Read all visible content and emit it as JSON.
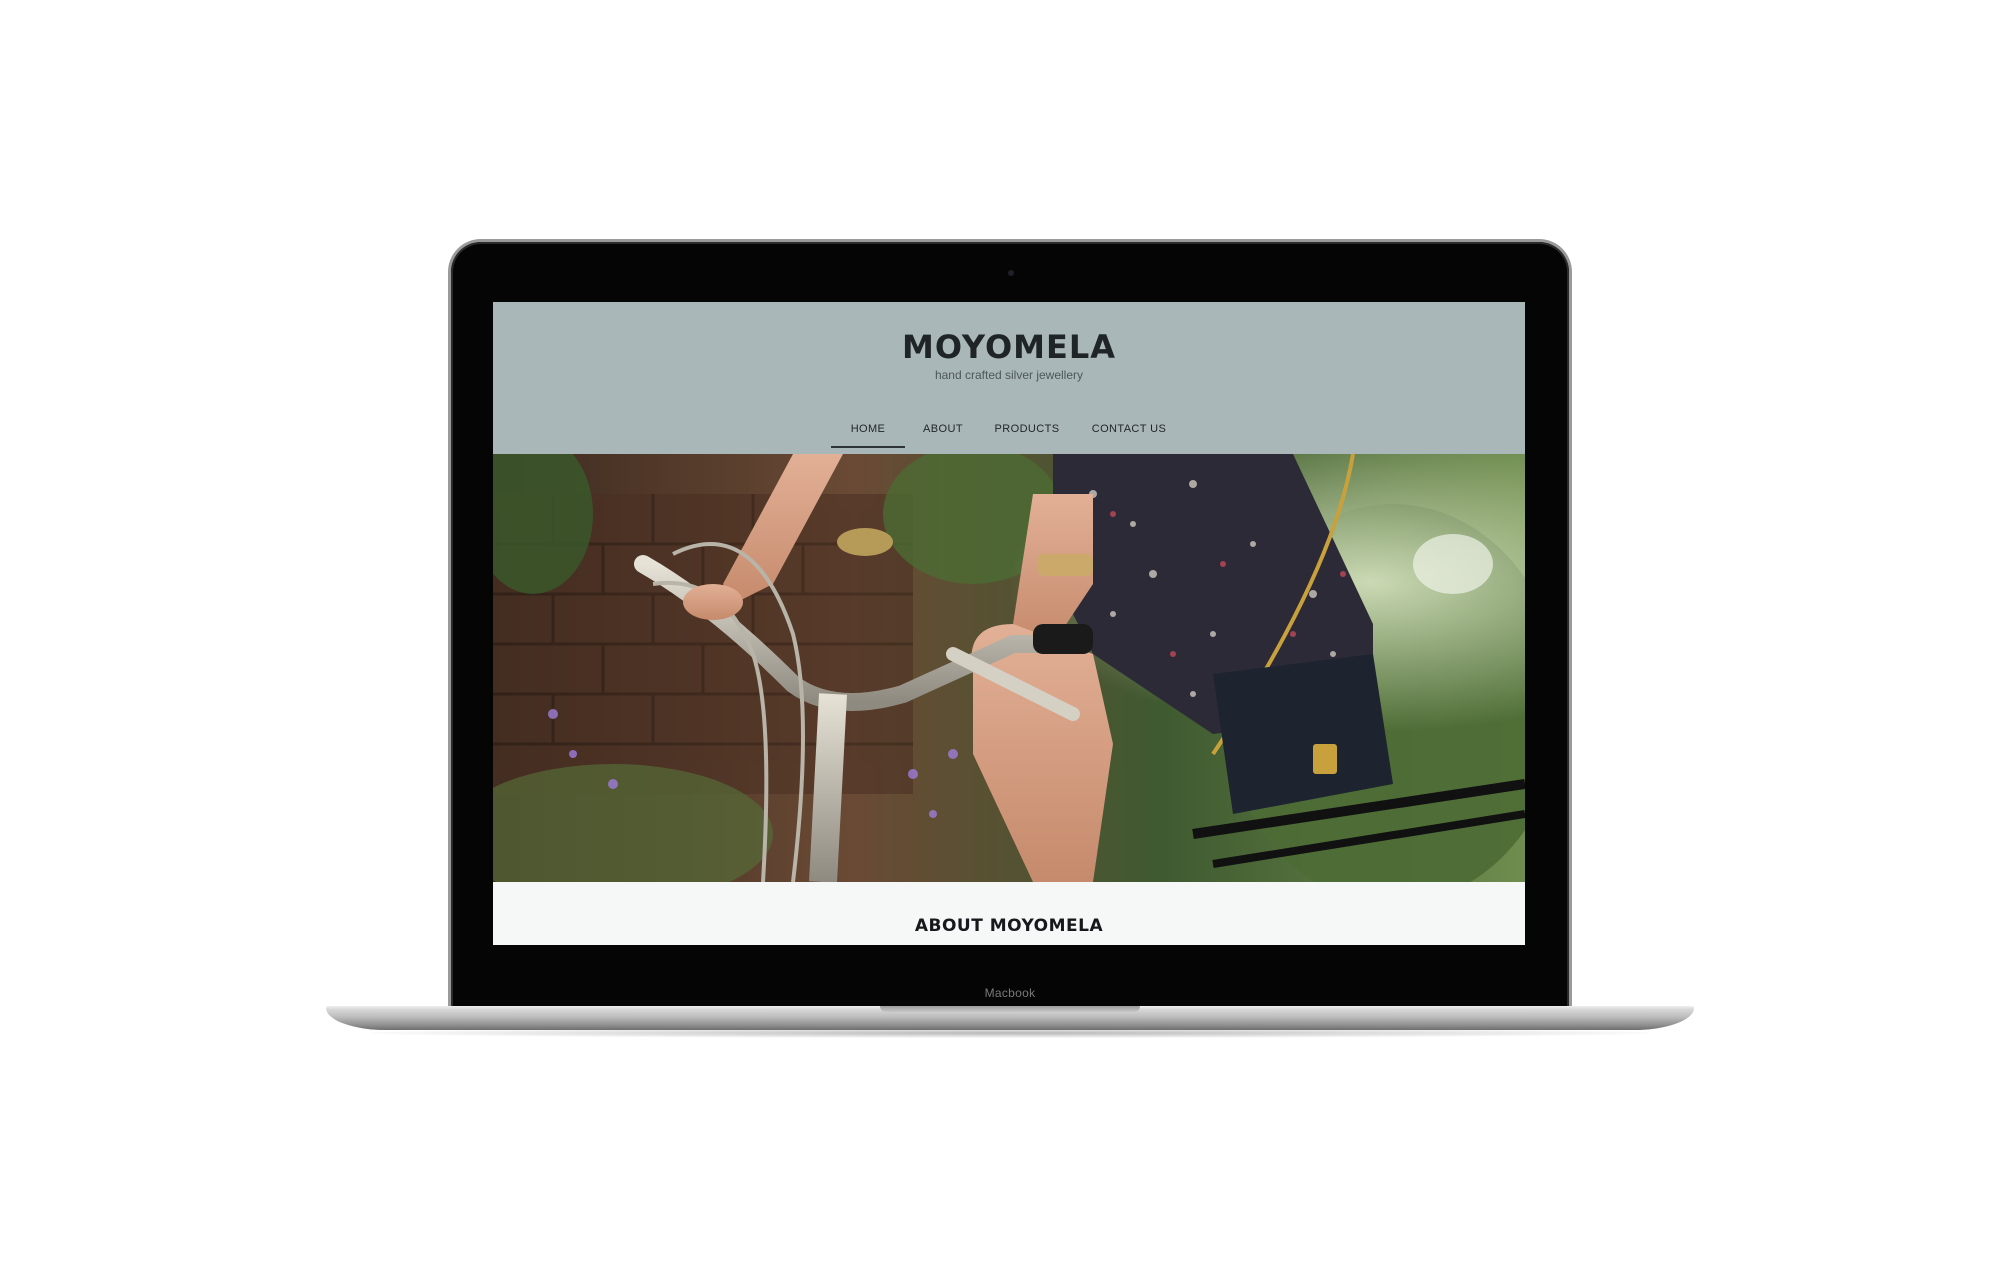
{
  "device": {
    "label": "Macbook"
  },
  "site": {
    "brand": "MOYOMELA",
    "tagline": "hand crafted silver jewellery",
    "nav": [
      {
        "label": "HOME",
        "active": true
      },
      {
        "label": "ABOUT",
        "active": false
      },
      {
        "label": "PRODUCTS",
        "active": false
      },
      {
        "label": "CONTACT US",
        "active": false
      }
    ],
    "hero_image": "woman-on-bicycle-photo",
    "about_title": "ABOUT MOYOMELA"
  },
  "colors": {
    "header_bg": "#aab7b9",
    "text_dark": "#1f2426",
    "page_bg": "#f6f8f8",
    "laptop_bezel": "#050505"
  }
}
